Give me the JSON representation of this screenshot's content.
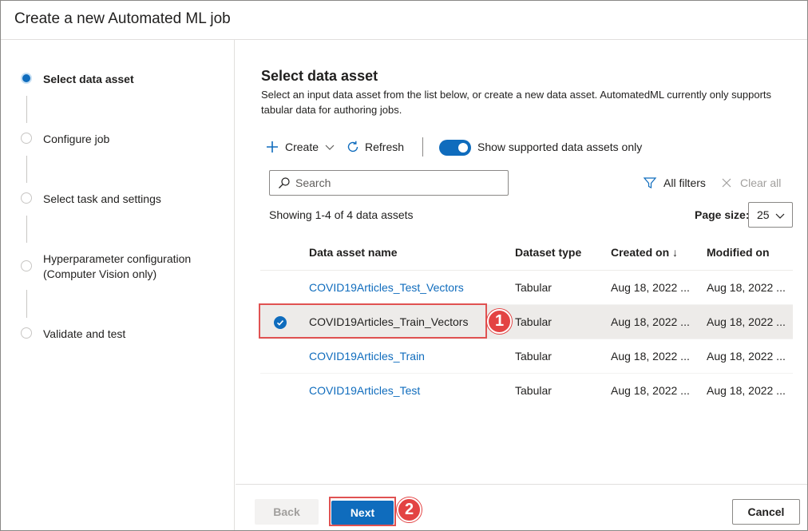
{
  "dialog": {
    "title": "Create a new Automated ML job"
  },
  "steps": [
    {
      "label": "Select data asset",
      "active": true
    },
    {
      "label": "Configure job",
      "active": false
    },
    {
      "label": "Select task and settings",
      "active": false
    },
    {
      "label": "Hyperparameter configuration",
      "label2": "(Computer Vision only)",
      "active": false
    },
    {
      "label": "Validate and test",
      "active": false
    }
  ],
  "main": {
    "title": "Select data asset",
    "description": "Select an input data asset from the list below, or create a new data asset. AutomatedML currently only supports tabular data for authoring jobs."
  },
  "toolbar": {
    "create_label": "Create",
    "refresh_label": "Refresh",
    "toggle_label": "Show supported data assets only",
    "toggle_on": true
  },
  "search": {
    "placeholder": "Search"
  },
  "filters": {
    "all_filters": "All filters",
    "clear_all": "Clear all"
  },
  "summary": {
    "showing": "Showing 1-4 of 4 data assets"
  },
  "page_size": {
    "label": "Page size:",
    "value": "25"
  },
  "table": {
    "columns": {
      "name": "Data asset name",
      "type": "Dataset type",
      "created": "Created on ↓",
      "modified": "Modified on"
    },
    "rows": [
      {
        "name": "COVID19Articles_Test_Vectors",
        "type": "Tabular",
        "created": "Aug 18, 2022 ...",
        "modified": "Aug 18, 2022 ...",
        "selected": false
      },
      {
        "name": "COVID19Articles_Train_Vectors",
        "type": "Tabular",
        "created": "Aug 18, 2022 ...",
        "modified": "Aug 18, 2022 ...",
        "selected": true
      },
      {
        "name": "COVID19Articles_Train",
        "type": "Tabular",
        "created": "Aug 18, 2022 ...",
        "modified": "Aug 18, 2022 ...",
        "selected": false
      },
      {
        "name": "COVID19Articles_Test",
        "type": "Tabular",
        "created": "Aug 18, 2022 ...",
        "modified": "Aug 18, 2022 ...",
        "selected": false
      }
    ]
  },
  "callouts": {
    "one": "1",
    "two": "2"
  },
  "footer": {
    "back_label": "Back",
    "next_label": "Next",
    "cancel_label": "Cancel"
  },
  "colors": {
    "accent": "#0f6cbd",
    "callout": "#e34343",
    "link": "#0f6cbd"
  }
}
